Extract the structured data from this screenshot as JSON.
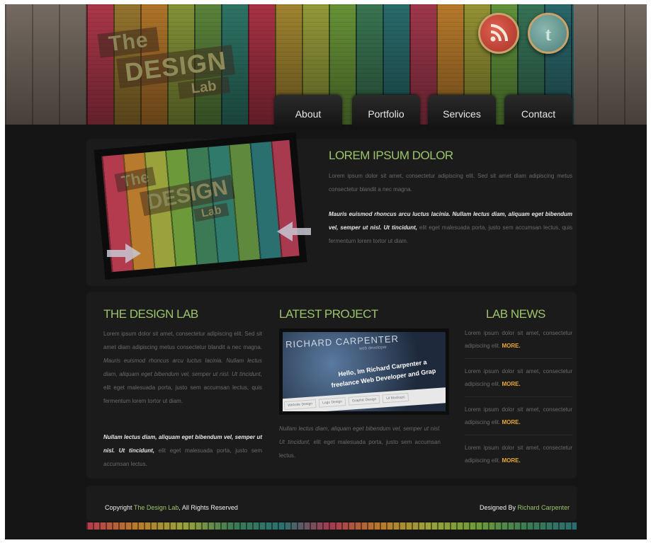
{
  "colors": {
    "accent_green": "#9cc46a",
    "more_orange": "#e8a834",
    "background": "#151515"
  },
  "logo": {
    "the": "The",
    "design": "DESIGN",
    "lab": "Lab"
  },
  "social": {
    "rss_icon": "rss-icon",
    "twitter_icon": "twitter-icon"
  },
  "nav": {
    "items": [
      {
        "label": "About"
      },
      {
        "label": "Portfolio"
      },
      {
        "label": "Services"
      },
      {
        "label": "Contact"
      }
    ]
  },
  "hero": {
    "title": "LOREM IPSUM DOLOR",
    "paragraph1": "Lorem ipsum dolor sit amet, consectetur adipiscing elit. Sed sit amet diam adipiscing metus consectetur blandit a nec magna.",
    "paragraph2_bold": "Mauris euismod rhoncus arcu luctus lacinia. Nullam lectus diam, aliquam eget bibendum vel, semper ut nisl. Ut tincidunt,",
    "paragraph2_rest": " elit eget malesuada porta, justo sem accumsan lectus, quis fermentum lorem tortor ut diam."
  },
  "columns": {
    "design_lab": {
      "title": "THE DESIGN LAB",
      "p1_start": "Lorem ipsum dolor sit amet, consectetur adipiscing elit. Sed sit amet diam adipiscing metus consectetur blandit a nec magna. ",
      "p1_italic": "Mauris euismod rhoncus arcu luctus lacinia. Nullam lectus diam, aliquam eget bibendum vel, semper ut nisl. Ut tincidunt,",
      "p1_end": " elit eget malesuada porta, justo sem accumsan lectus, quis fermentum lorem tortor ut diam.",
      "p2_bold": "Nullam lectus diam, aliquam eget bibendum vel, semper ut nisl. Ut tincidunt,",
      "p2_rest": " elit eget malesuada porta, justo sem accumsan lectus."
    },
    "latest_project": {
      "title": "LATEST PROJECT",
      "screenshot": {
        "name": "RICHARD CARPENTER",
        "sub": "web developer",
        "hello_line1": "Hello, Im Richard Carpenter a",
        "hello_line2": "freelance Web Developer and Grap",
        "tabs": [
          "Website Design",
          "Logo Design",
          "Graphic Design",
          "UI Mockups"
        ]
      },
      "p_italic": "Nullam lectus diam, aliquam eget bibendum vel, semper ut nisl. Ut tincidunt,",
      "p_rest": " elit eget malesuada porta, justo sem accumsan lectus."
    },
    "lab_news": {
      "title": "LAB NEWS",
      "items": [
        {
          "text": "Lorem ipsum dolor sit amet, consectetur adipiscing elit. ",
          "more": "MORE."
        },
        {
          "text": "Lorem ipsum dolor sit amet, consectetur adipiscing elit. ",
          "more": "MORE."
        },
        {
          "text": "Lorem ipsum dolor sit amet, consectetur adipiscing elit. ",
          "more": "MORE."
        },
        {
          "text": "Lorem ipsum dolor sit amet, consectetur adipiscing elit. ",
          "more": "MORE."
        }
      ]
    }
  },
  "footer": {
    "copyright_prefix": "Copyright ",
    "copyright_link": "The Design Lab",
    "copyright_suffix": ", All Rights Reserved",
    "designed_prefix": "Designed By ",
    "designed_link": "Richard Carpenter"
  }
}
